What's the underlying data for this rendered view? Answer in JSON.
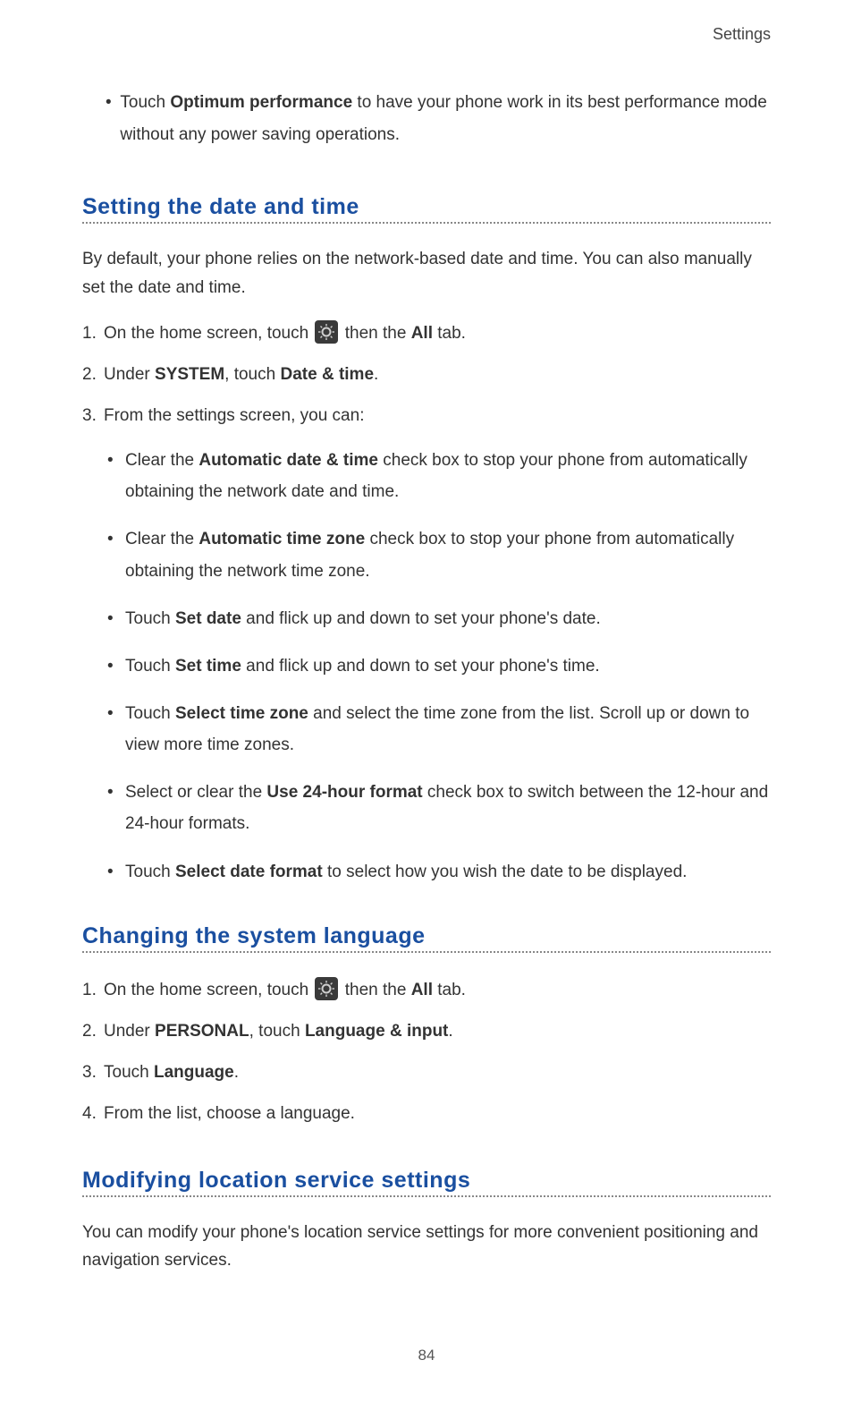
{
  "header": {
    "label": "Settings"
  },
  "top_bullet": {
    "prefix": "Touch ",
    "bold": "Optimum performance",
    "rest": " to have your phone work in its best performance mode without any power saving operations."
  },
  "sections": {
    "datetime": {
      "heading": "Setting the date and time",
      "intro": "By default, your phone relies on the network-based date and time. You can also manually set the date and time.",
      "steps": [
        {
          "prefix": "On the home screen, touch ",
          "icon": "settings-icon",
          "mid": " then the ",
          "bold": "All",
          "suffix": " tab."
        },
        {
          "prefix": "Under ",
          "bold1": "SYSTEM",
          "mid": ", touch ",
          "bold2": "Date & time",
          "suffix": "."
        },
        {
          "prefix": "From the settings screen, you can:"
        }
      ],
      "subitems": [
        {
          "pre": "Clear the ",
          "b": "Automatic date & time",
          "post": " check box to stop your phone from automatically obtaining the network date and time."
        },
        {
          "pre": "Clear the ",
          "b": "Automatic time zone",
          "post": " check box to stop your phone from automatically obtaining the network time zone."
        },
        {
          "pre": "Touch ",
          "b": "Set date",
          "post": " and flick up and down to set your phone's date."
        },
        {
          "pre": "Touch ",
          "b": "Set time",
          "post": " and flick up and down to set your phone's time."
        },
        {
          "pre": "Touch ",
          "b": "Select time zone",
          "post": " and select the time zone from the list. Scroll up or down to view more time zones."
        },
        {
          "pre": "Select or clear the ",
          "b": "Use 24-hour format",
          "post": " check box to switch between the 12-hour and 24-hour formats."
        },
        {
          "pre": "Touch ",
          "b": "Select date format",
          "post": " to select how you wish the date to be displayed."
        }
      ]
    },
    "language": {
      "heading": "Changing the system language",
      "steps": [
        {
          "prefix": "On the home screen, touch ",
          "icon": "settings-icon",
          "mid": " then the ",
          "bold": "All",
          "suffix": " tab."
        },
        {
          "prefix": "Under ",
          "bold1": "PERSONAL",
          "mid": ", touch ",
          "bold2": "Language & input",
          "suffix": "."
        },
        {
          "prefix": "Touch ",
          "bold1": "Language",
          "suffix": "."
        },
        {
          "prefix": "From the list, choose a language."
        }
      ]
    },
    "location": {
      "heading": "Modifying location service settings",
      "intro": "You can modify your phone's location service settings for more convenient positioning and navigation services."
    }
  },
  "page_number": "84"
}
